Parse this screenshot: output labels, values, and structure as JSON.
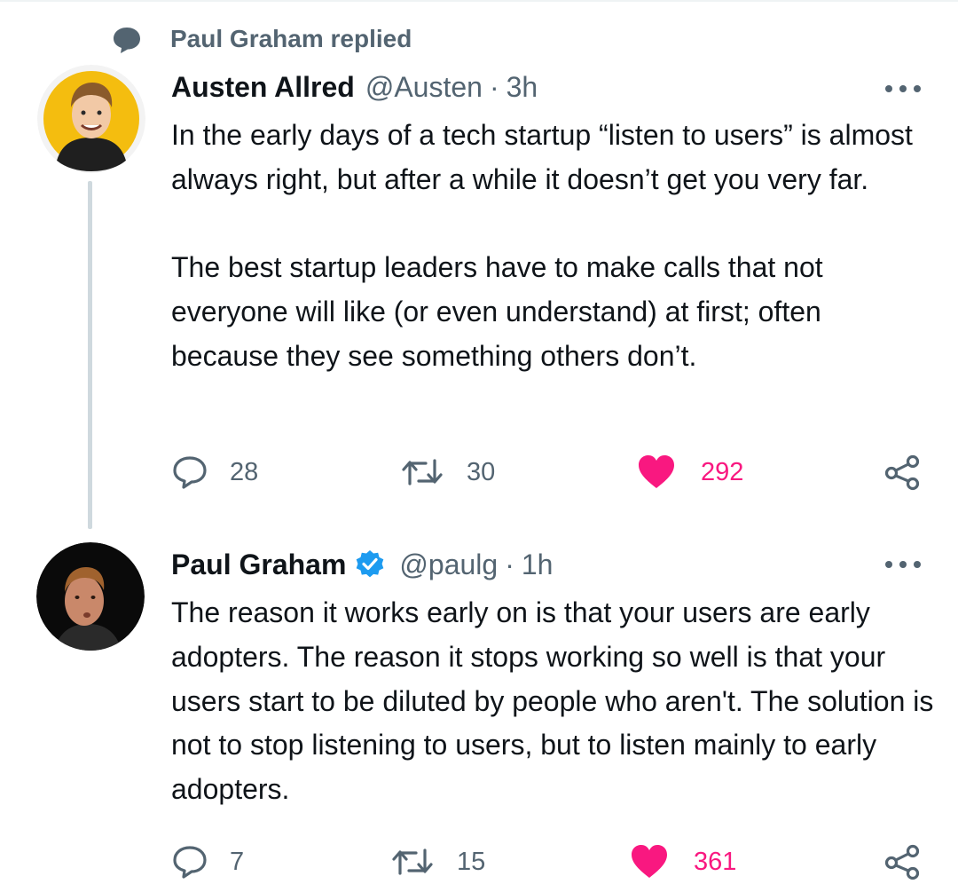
{
  "context": {
    "icon": "speech-bubble-icon",
    "text": "Paul Graham replied"
  },
  "tweets": [
    {
      "display_name": "Austen Allred",
      "handle": "@Austen",
      "separator": "·",
      "time": "3h",
      "verified": false,
      "more_icon": "ellipsis-icon",
      "paragraphs": [
        "In the early days of a tech startup “listen to users” is almost always right, but after a while it doesn’t get you very far.",
        "The best startup leaders have to make calls that not everyone will like (or even understand) at first; often because they see something others don’t."
      ],
      "actions": {
        "replies": "28",
        "retweets": "30",
        "likes": "292",
        "liked": true
      }
    },
    {
      "display_name": "Paul Graham",
      "handle": "@paulg",
      "separator": "·",
      "time": "1h",
      "verified": true,
      "more_icon": "ellipsis-icon",
      "paragraphs": [
        "The reason it works early on is that your users are early adopters. The reason it stops working so well is that your users start to be diluted by people who aren't. The solution is not to stop listening to users, but to listen mainly to early adopters."
      ],
      "actions": {
        "replies": "7",
        "retweets": "15",
        "likes": "361",
        "liked": true
      }
    }
  ],
  "colors": {
    "text_primary": "#0f1419",
    "text_secondary": "#536471",
    "like_pink": "#f91880",
    "verified_blue": "#1d9bf0",
    "thread_line": "#cfd9de"
  }
}
